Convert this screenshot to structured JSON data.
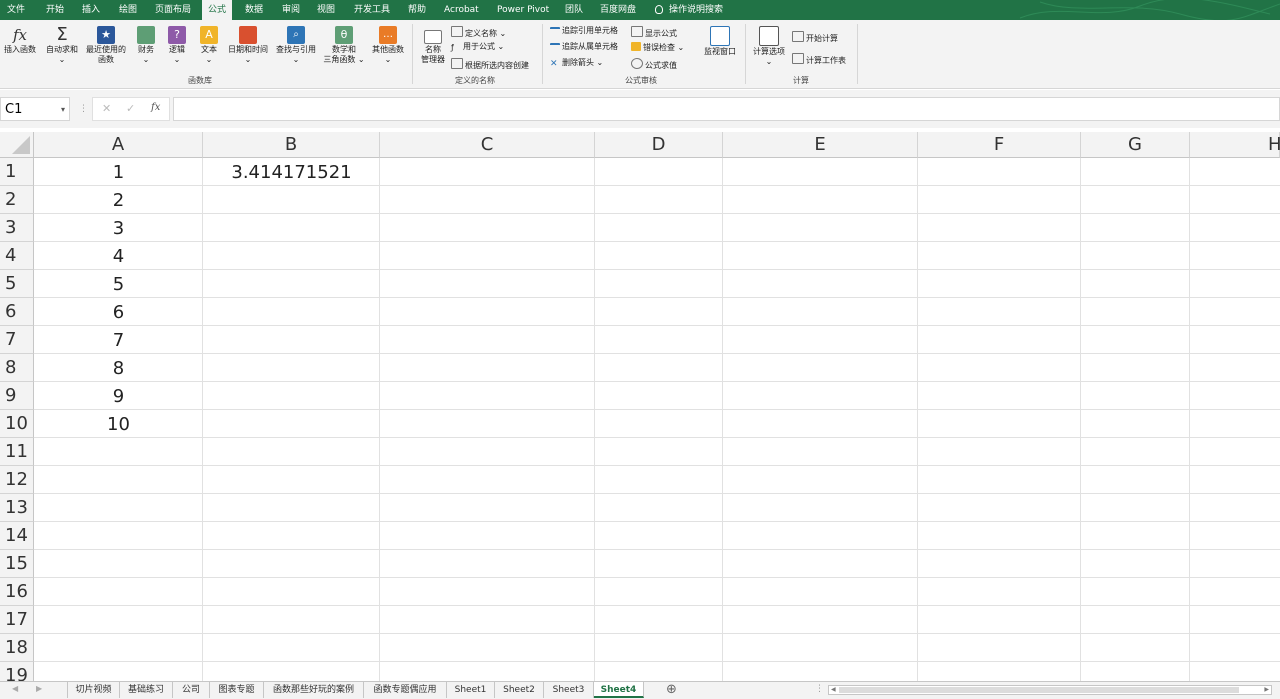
{
  "menu": {
    "items": [
      "文件",
      "开始",
      "插入",
      "绘图",
      "页面布局",
      "公式",
      "数据",
      "审阅",
      "视图",
      "开发工具",
      "帮助",
      "Acrobat",
      "Power Pivot",
      "团队",
      "百度网盘"
    ],
    "active": "公式",
    "tell_me": "操作说明搜索"
  },
  "ribbon": {
    "function_library": {
      "insert_function": "插入函数",
      "autosum": "自动求和",
      "recent_1": "最近使用的",
      "recent_2": "函数",
      "financial": "财务",
      "logical": "逻辑",
      "text": "文本",
      "datetime": "日期和时间",
      "lookup": "查找与引用",
      "math_1": "数学和",
      "math_2": "三角函数",
      "other": "其他函数",
      "group_label": "函数库"
    },
    "defined_names": {
      "name_manager_1": "名称",
      "name_manager_2": "管理器",
      "define_name": "定义名称",
      "use_in_formula": "用于公式",
      "create_from_selection": "根据所选内容创建",
      "group_label": "定义的名称"
    },
    "formula_auditing": {
      "trace_precedents": "追踪引用单元格",
      "trace_dependents": "追踪从属单元格",
      "remove_arrows": "删除箭头",
      "show_formulas": "显示公式",
      "error_checking": "错误检查",
      "evaluate_formula": "公式求值",
      "watch_window": "监视窗口",
      "group_label": "公式审核"
    },
    "calculation": {
      "options": "计算选项",
      "calc_now": "开始计算",
      "calc_sheet": "计算工作表",
      "group_label": "计算"
    },
    "colors": {
      "brand": "#217346"
    }
  },
  "formula_bar": {
    "name_box": "C1",
    "cancel_glyph": "✕",
    "enter_glyph": "✓",
    "fx_glyph": "fx",
    "formula": ""
  },
  "sheet": {
    "columns": [
      "A",
      "B",
      "C",
      "D",
      "E",
      "F",
      "G",
      "H"
    ],
    "rows": [
      "1",
      "2",
      "3",
      "4",
      "5",
      "6",
      "7",
      "8",
      "9",
      "10",
      "11",
      "12",
      "13",
      "14",
      "15",
      "16",
      "17",
      "18",
      "19"
    ],
    "col_a": [
      "1",
      "2",
      "3",
      "4",
      "5",
      "6",
      "7",
      "8",
      "9",
      "10"
    ],
    "b1": "3.414171521"
  },
  "tabs": {
    "items": [
      "切片视频",
      "基础练习",
      "公司",
      "图表专题",
      "函数那些好玩的案例",
      "函数专题偶应用",
      "Sheet1",
      "Sheet2",
      "Sheet3",
      "Sheet4"
    ],
    "active": "Sheet4",
    "add_glyph": "⊕"
  }
}
